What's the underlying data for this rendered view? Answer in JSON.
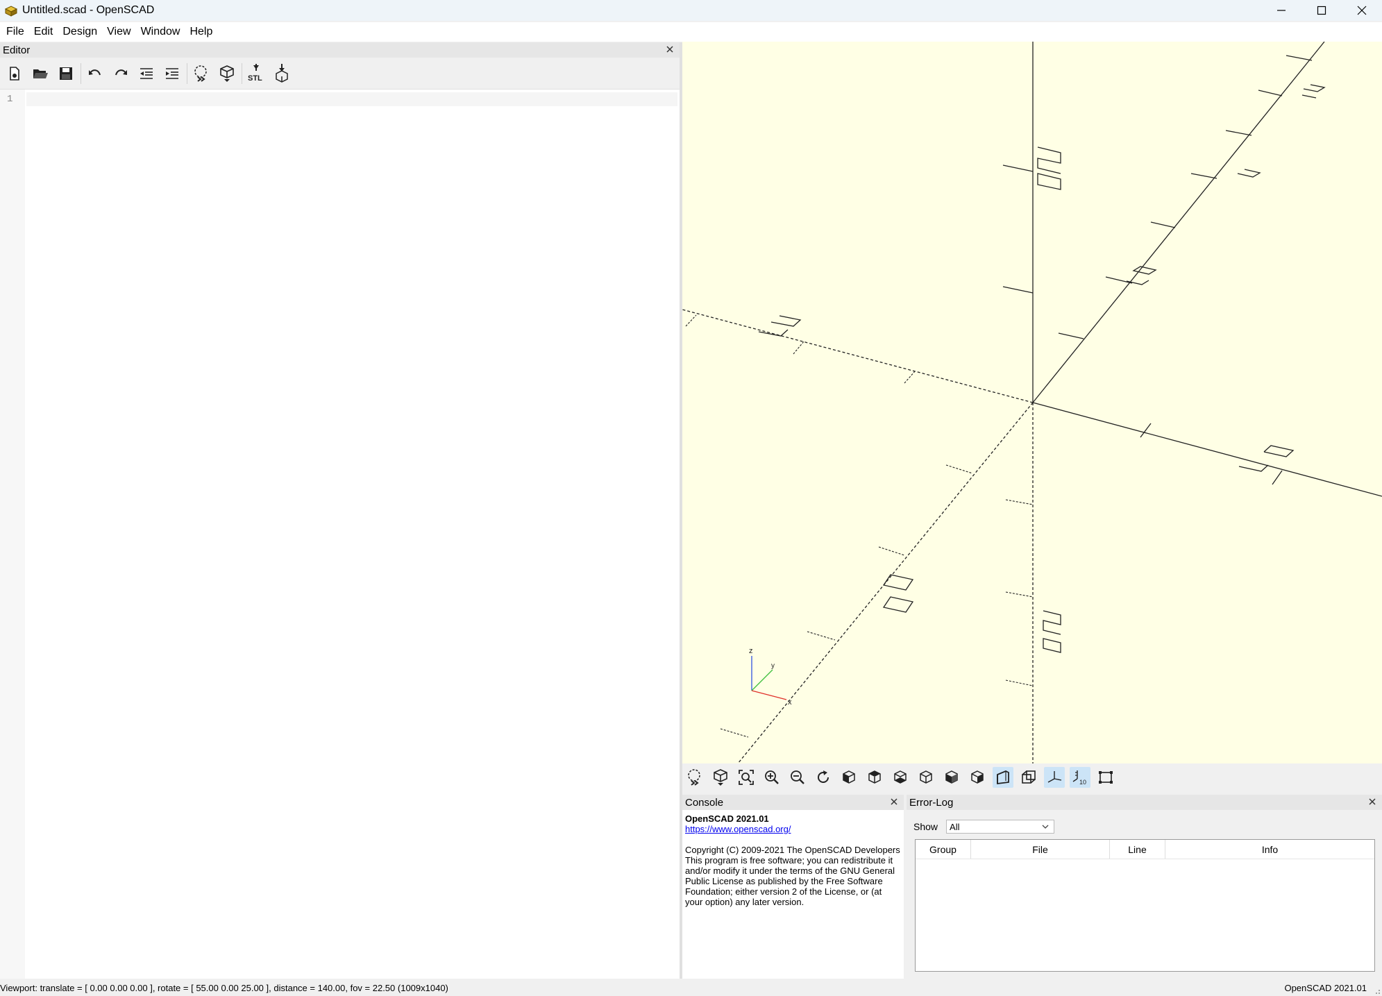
{
  "window": {
    "title": "Untitled.scad - OpenSCAD"
  },
  "menu": [
    "File",
    "Edit",
    "Design",
    "View",
    "Window",
    "Help"
  ],
  "editor": {
    "title": "Editor",
    "line_numbers": [
      "1"
    ],
    "toolbar": [
      "new-file",
      "open-file",
      "save",
      "undo",
      "redo",
      "unindent",
      "indent",
      "preview",
      "render",
      "export-stl",
      "send-to-3d-print"
    ]
  },
  "viewport": {
    "tick_labels": [
      "20",
      "20",
      "20",
      "20",
      "20",
      "20"
    ],
    "axis_labels": {
      "x": "x",
      "y": "y",
      "z": "z"
    },
    "toolbar": [
      "preview",
      "render",
      "view-all",
      "zoom-in",
      "zoom-out",
      "reset-view",
      "view-right",
      "view-top",
      "view-bottom",
      "view-left",
      "view-front",
      "view-back",
      "perspective",
      "orthogonal",
      "show-axes",
      "show-scale-markers",
      "show-edges"
    ]
  },
  "console": {
    "title": "Console",
    "heading": "OpenSCAD 2021.01",
    "link": "https://www.openscad.org/",
    "lines": [
      "Copyright (C) 2009-2021 The OpenSCAD Developers",
      "This program is free software; you can redistribute it and/or modify it under the terms of the GNU General Public License as published by the Free Software Foundation; either version 2 of the License, or (at your option) any later version."
    ]
  },
  "errorlog": {
    "title": "Error-Log",
    "show_label": "Show",
    "show_value": "All",
    "columns": [
      "Group",
      "File",
      "Line",
      "Info"
    ]
  },
  "status": {
    "left": "Viewport: translate = [ 0.00 0.00 0.00 ], rotate = [ 55.00 0.00 25.00 ], distance = 140.00, fov = 22.50 (1009x1040)",
    "right": "OpenSCAD 2021.01"
  },
  "colors": {
    "viewport_bg": "#ffffe5",
    "axis_x": "#e0302a",
    "axis_y": "#40c040",
    "axis_z": "#3050e0"
  }
}
